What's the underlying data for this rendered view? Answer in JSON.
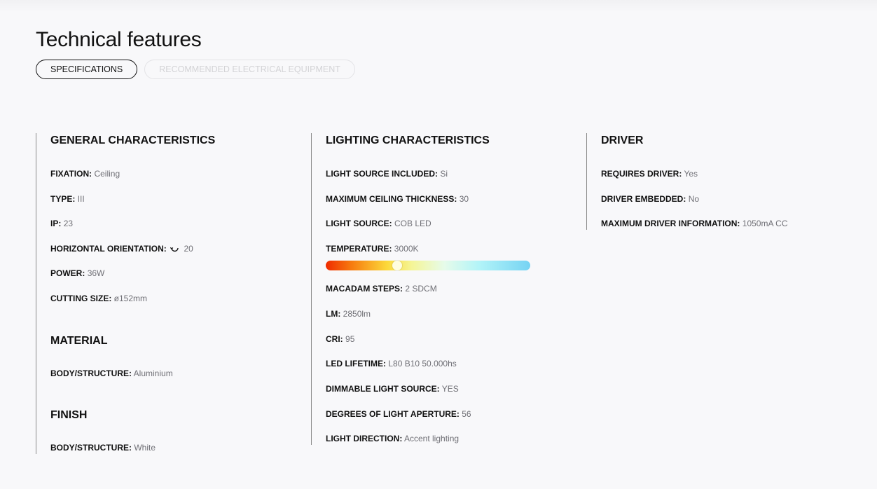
{
  "title": "Technical features",
  "tabs": [
    {
      "label": "SPECIFICATIONS",
      "active": true
    },
    {
      "label": "RECOMMENDED ELECTRICAL EQUIPMENT",
      "active": false
    }
  ],
  "general": {
    "title": "GENERAL CHARACTERISTICS",
    "rows": [
      {
        "label": "FIXATION:",
        "value": "Ceiling"
      },
      {
        "label": "TYPE:",
        "value": "III"
      },
      {
        "label": "IP:",
        "value": "23"
      },
      {
        "label": "HORIZONTAL ORIENTATION:",
        "value": "20",
        "icon": "rotate-icon"
      },
      {
        "label": "POWER:",
        "value": "36W"
      },
      {
        "label": "CUTTING SIZE:",
        "value": "ø152mm"
      }
    ]
  },
  "material": {
    "title": "MATERIAL",
    "rows": [
      {
        "label": "BODY/STRUCTURE:",
        "value": "Aluminium"
      }
    ]
  },
  "finish": {
    "title": "FINISH",
    "rows": [
      {
        "label": "BODY/STRUCTURE:",
        "value": "White"
      }
    ]
  },
  "lighting": {
    "title": "LIGHTING CHARACTERISTICS",
    "rows": [
      {
        "label": "LIGHT SOURCE INCLUDED:",
        "value": "Si"
      },
      {
        "label": "MAXIMUM CEILING THICKNESS:",
        "value": "30"
      },
      {
        "label": "LIGHT SOURCE:",
        "value": "COB LED"
      },
      {
        "label": "TEMPERATURE:",
        "value": "3000K"
      },
      {
        "label": "MACADAM STEPS:",
        "value": "2 SDCM"
      },
      {
        "label": "LM:",
        "value": "2850lm"
      },
      {
        "label": "CRI:",
        "value": "95"
      },
      {
        "label": "LED LIFETIME:",
        "value": "L80 B10 50.000hs"
      },
      {
        "label": "DIMMABLE LIGHT SOURCE:",
        "value": "YES"
      },
      {
        "label": "DEGREES OF LIGHT APERTURE:",
        "value": "56"
      },
      {
        "label": "LIGHT DIRECTION:",
        "value": "Accent lighting"
      }
    ],
    "temperature_scale": {
      "position_fraction": 0.35
    }
  },
  "driver": {
    "title": "DRIVER",
    "rows": [
      {
        "label": "REQUIRES DRIVER:",
        "value": "Yes"
      },
      {
        "label": "DRIVER EMBEDDED:",
        "value": "No"
      },
      {
        "label": "MAXIMUM DRIVER INFORMATION:",
        "value": "1050mA CC"
      }
    ]
  },
  "colors": {
    "background": "#f8f8fa",
    "text": "#111111",
    "value_text": "#6f6f75",
    "divider": "#8a8a8a",
    "tab_inactive": "#d3d3d6"
  }
}
